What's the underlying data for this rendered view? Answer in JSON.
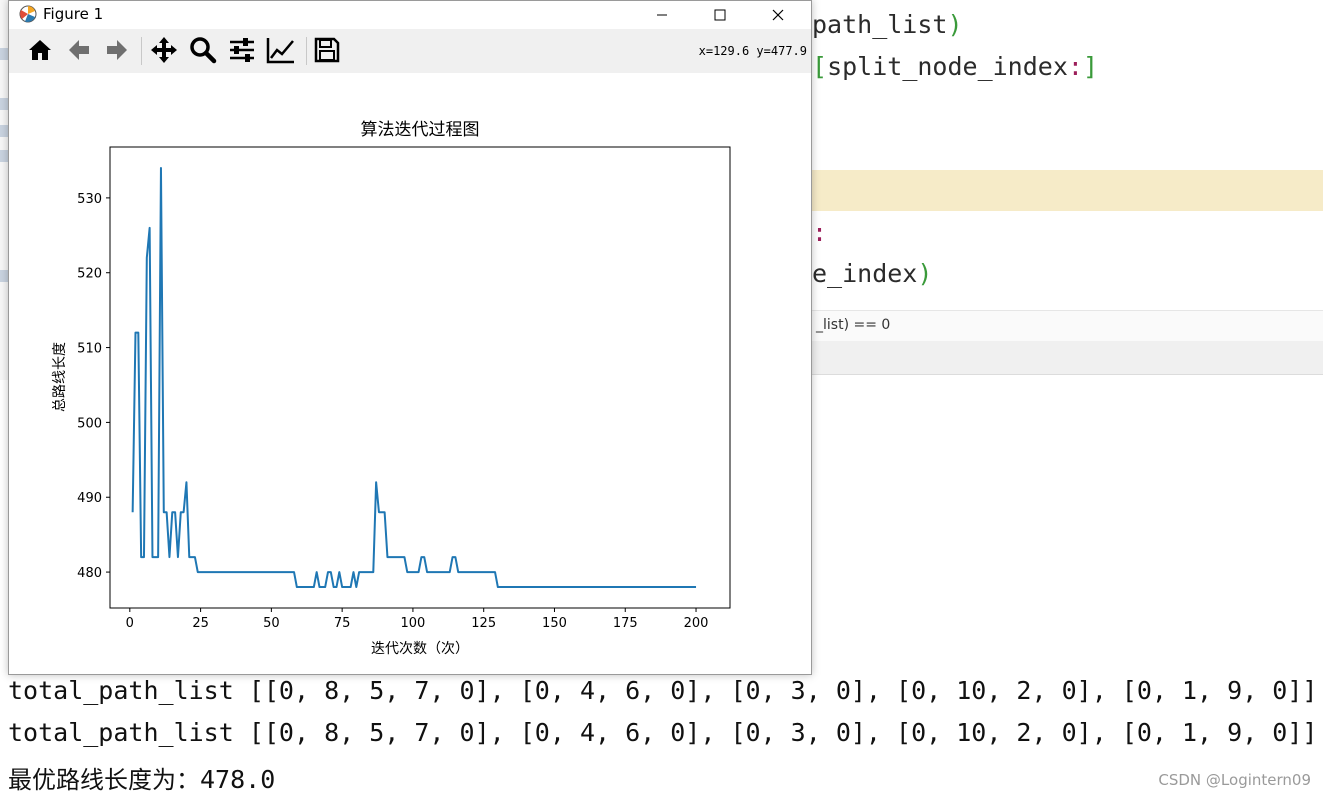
{
  "window": {
    "title": "Figure 1",
    "coords_readout": "x=129.6  y=477.9",
    "toolbar": [
      "home-icon",
      "back-arrow-icon",
      "forward-arrow-icon",
      "pan-icon",
      "zoom-icon",
      "subplots-icon",
      "edit-curves-icon",
      "save-icon"
    ]
  },
  "editor": {
    "line1": "path_list",
    "line2": "split_node_index",
    "line4": "e_index",
    "status_text": "_list) == 0"
  },
  "console": {
    "line1": "total_path_list [[0, 8, 5, 7, 0], [0, 4, 6, 0], [0, 3, 0], [0, 10, 2, 0], [0, 1, 9, 0]]",
    "line2": "total_path_list [[0, 8, 5, 7, 0], [0, 4, 6, 0], [0, 3, 0], [0, 10, 2, 0], [0, 1, 9, 0]]",
    "result_label": "最优路线长度为：",
    "result_value": "478.0"
  },
  "watermark": "CSDN @Logintern09",
  "chart_data": {
    "type": "line",
    "title": "算法迭代过程图",
    "xlabel": "迭代次数（次）",
    "ylabel": "总路线长度",
    "xlim": [
      -7,
      212
    ],
    "ylim": [
      475.2,
      536.8
    ],
    "xticks": [
      0,
      25,
      50,
      75,
      100,
      125,
      150,
      175,
      200
    ],
    "yticks": [
      480,
      490,
      500,
      510,
      520,
      530
    ],
    "color": "#1f77b4",
    "x": [
      1,
      2,
      3,
      4,
      5,
      6,
      7,
      8,
      9,
      10,
      11,
      12,
      13,
      14,
      15,
      16,
      17,
      18,
      19,
      20,
      21,
      22,
      23,
      24,
      25,
      30,
      35,
      40,
      45,
      50,
      55,
      58,
      59,
      60,
      61,
      62,
      63,
      64,
      65,
      66,
      67,
      68,
      69,
      70,
      71,
      72,
      73,
      74,
      75,
      76,
      77,
      78,
      79,
      80,
      81,
      82,
      83,
      84,
      85,
      86,
      87,
      88,
      89,
      90,
      91,
      92,
      93,
      94,
      95,
      96,
      97,
      98,
      99,
      100,
      101,
      102,
      103,
      104,
      105,
      106,
      107,
      108,
      109,
      110,
      111,
      112,
      113,
      114,
      115,
      116,
      117,
      118,
      119,
      120,
      121,
      122,
      123,
      124,
      125,
      126,
      127,
      128,
      129,
      130,
      131,
      135,
      140,
      150,
      160,
      170,
      180,
      190,
      200
    ],
    "y": [
      488,
      512,
      512,
      482,
      482,
      522,
      526,
      482,
      482,
      482,
      534,
      488,
      488,
      482,
      488,
      488,
      482,
      488,
      488,
      492,
      482,
      482,
      482,
      480,
      480,
      480,
      480,
      480,
      480,
      480,
      480,
      480,
      478,
      478,
      478,
      478,
      478,
      478,
      478,
      480,
      478,
      478,
      478,
      480,
      480,
      478,
      478,
      480,
      478,
      478,
      478,
      478,
      480,
      478,
      480,
      480,
      480,
      480,
      480,
      480,
      492,
      488,
      488,
      488,
      482,
      482,
      482,
      482,
      482,
      482,
      482,
      480,
      480,
      480,
      480,
      480,
      482,
      482,
      480,
      480,
      480,
      480,
      480,
      480,
      480,
      480,
      480,
      482,
      482,
      480,
      480,
      480,
      480,
      480,
      480,
      480,
      480,
      480,
      480,
      480,
      480,
      480,
      480,
      478,
      478,
      478,
      478,
      478,
      478,
      478,
      478,
      478,
      478
    ]
  }
}
